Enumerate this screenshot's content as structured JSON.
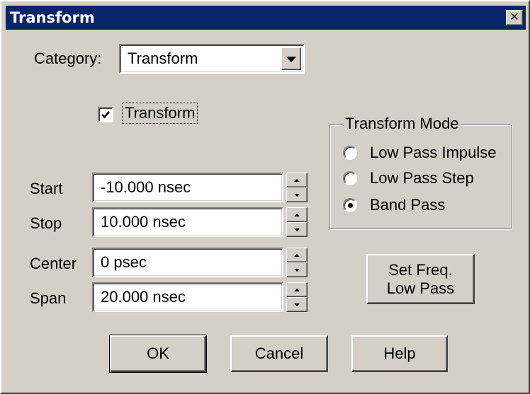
{
  "window": {
    "title": "Transform",
    "close_glyph": "✕"
  },
  "category": {
    "label": "Category:",
    "value": "Transform"
  },
  "transform_checkbox": {
    "label": "Transform",
    "checked": true
  },
  "transform_mode": {
    "title": "Transform Mode",
    "options": [
      {
        "label": "Low Pass Impulse",
        "selected": false
      },
      {
        "label": "Low Pass Step",
        "selected": false
      },
      {
        "label": "Band Pass",
        "selected": true
      }
    ]
  },
  "fields": {
    "start": {
      "label": "Start",
      "value": "-10.000 nsec"
    },
    "stop": {
      "label": "Stop",
      "value": "10.000 nsec"
    },
    "center": {
      "label": "Center",
      "value": "0 psec"
    },
    "span": {
      "label": "Span",
      "value": "20.000 nsec"
    }
  },
  "set_freq_button": {
    "line1": "Set Freq.",
    "line2": "Low Pass"
  },
  "buttons": {
    "ok": "OK",
    "cancel": "Cancel",
    "help": "Help"
  },
  "colors": {
    "titlebar": "#0a246a",
    "face": "#d4d0c8"
  }
}
